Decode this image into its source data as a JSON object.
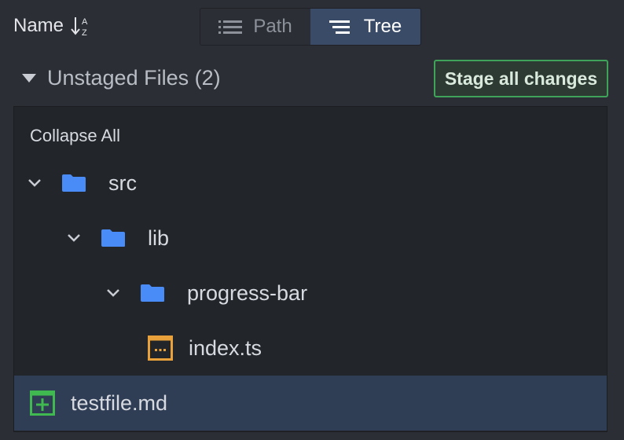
{
  "toolbar": {
    "sort_label": "Name",
    "view_modes": [
      {
        "label": "Path",
        "active": false
      },
      {
        "label": "Tree",
        "active": true
      }
    ]
  },
  "section": {
    "title": "Unstaged Files (2)",
    "stage_all_label": "Stage all changes"
  },
  "tree": {
    "collapse_all_label": "Collapse All",
    "nodes": [
      {
        "label": "src",
        "type": "folder",
        "depth": 0,
        "expanded": true
      },
      {
        "label": "lib",
        "type": "folder",
        "depth": 1,
        "expanded": true
      },
      {
        "label": "progress-bar",
        "type": "folder",
        "depth": 2,
        "expanded": true
      },
      {
        "label": "index.ts",
        "type": "file",
        "status": "modified",
        "icon": "modified-file-icon"
      },
      {
        "label": "testfile.md",
        "type": "file",
        "status": "added",
        "icon": "added-file-icon",
        "selected": true
      }
    ]
  },
  "colors": {
    "accent_active": "#3a4b68",
    "stage_border": "#3fa35a",
    "folder": "#4a8cf7",
    "modified": "#e9a23b",
    "added": "#3fb950",
    "selected_row": "#2f3d55"
  }
}
